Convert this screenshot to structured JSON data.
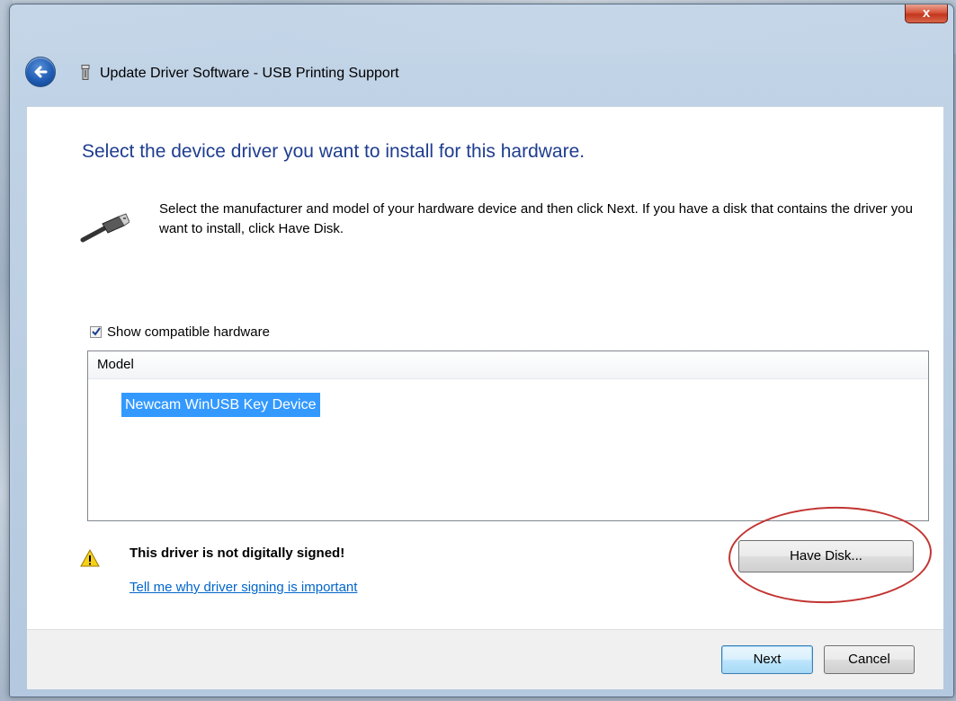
{
  "window": {
    "title": "Update Driver Software - USB Printing Support",
    "close_label": "x"
  },
  "main": {
    "heading": "Select the device driver you want to install for this hardware.",
    "description": "Select the manufacturer and model of your hardware device and then click Next. If you have a disk that contains the driver you want to install, click Have Disk.",
    "show_compatible": {
      "label": "Show compatible hardware",
      "checked": true
    },
    "model_list": {
      "column_header": "Model",
      "items": [
        "Newcam WinUSB Key Device"
      ],
      "selected_index": 0
    },
    "warning": {
      "text": "This driver is not digitally signed!",
      "link": "Tell me why driver signing is important"
    },
    "have_disk_label": "Have Disk..."
  },
  "footer": {
    "next_label": "Next",
    "cancel_label": "Cancel"
  },
  "colors": {
    "heading": "#1e3d8f",
    "selection": "#3399ff",
    "link": "#0066cc",
    "annotation_ring": "#c23431"
  }
}
